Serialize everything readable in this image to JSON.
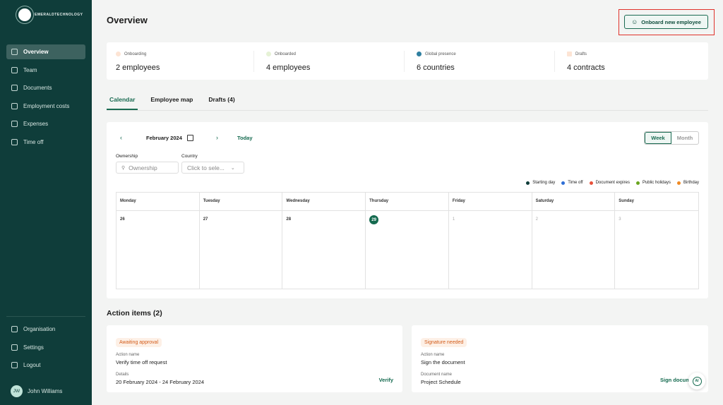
{
  "brand": "EMERALDTECHNOLOGY",
  "sidebar": {
    "items": [
      {
        "label": "Overview",
        "icon": "bar-chart-icon"
      },
      {
        "label": "Team",
        "icon": "users-icon"
      },
      {
        "label": "Documents",
        "icon": "documents-icon"
      },
      {
        "label": "Employment costs",
        "icon": "calculator-icon"
      },
      {
        "label": "Expenses",
        "icon": "coins-icon"
      },
      {
        "label": "Time off",
        "icon": "calendar-icon"
      }
    ],
    "bottom": [
      {
        "label": "Organisation",
        "icon": "building-icon"
      },
      {
        "label": "Settings",
        "icon": "gear-icon"
      },
      {
        "label": "Logout",
        "icon": "logout-icon"
      }
    ],
    "user": {
      "initials": "JW",
      "name": "John Williams"
    }
  },
  "header": {
    "title": "Overview",
    "onboard_label": "Onboard new employee"
  },
  "stats": [
    {
      "label": "Onboarding",
      "value": "2 employees",
      "color": "#f08a4b"
    },
    {
      "label": "Onboarded",
      "value": "4 employees",
      "color": "#8bbf3f"
    },
    {
      "label": "Global presence",
      "value": "6 countries",
      "color": "#2f7fa0"
    },
    {
      "label": "Drafts",
      "value": "4 contracts",
      "color": "#f08a4b"
    }
  ],
  "tabs": [
    "Calendar",
    "Employee map",
    "Drafts (4)"
  ],
  "calendar": {
    "month": "February 2024",
    "today": "Today",
    "week": "Week",
    "month_label": "Month",
    "ownership_label": "Ownership",
    "ownership_placeholder": "Ownership",
    "country_label": "Country",
    "country_placeholder": "Click to sele...",
    "legend": [
      {
        "label": "Starting day",
        "color": "#0f3d3a"
      },
      {
        "label": "Time off",
        "color": "#2f6fd6"
      },
      {
        "label": "Document expires",
        "color": "#e8503a"
      },
      {
        "label": "Public holidays",
        "color": "#6aa51f"
      },
      {
        "label": "Birthday",
        "color": "#ef8a24"
      }
    ],
    "days": [
      "Monday",
      "Tuesday",
      "Wednesday",
      "Thursday",
      "Friday",
      "Saturday",
      "Sunday"
    ],
    "dates": [
      "26",
      "27",
      "28",
      "29",
      "1",
      "2",
      "3"
    ]
  },
  "actions": {
    "title": "Action items (2)",
    "items": [
      {
        "badge": "Awaiting approval",
        "l1": "Action name",
        "v1": "Verify time off request",
        "l2": "Details",
        "v2": "20 February 2024 - 24 February 2024",
        "link": "Verify"
      },
      {
        "badge": "Signature needed",
        "l1": "Action name",
        "v1": "Sign the document",
        "l2": "Document name",
        "v2": "Project Schedule",
        "link": "Sign document"
      }
    ]
  },
  "ai_label": "AI"
}
